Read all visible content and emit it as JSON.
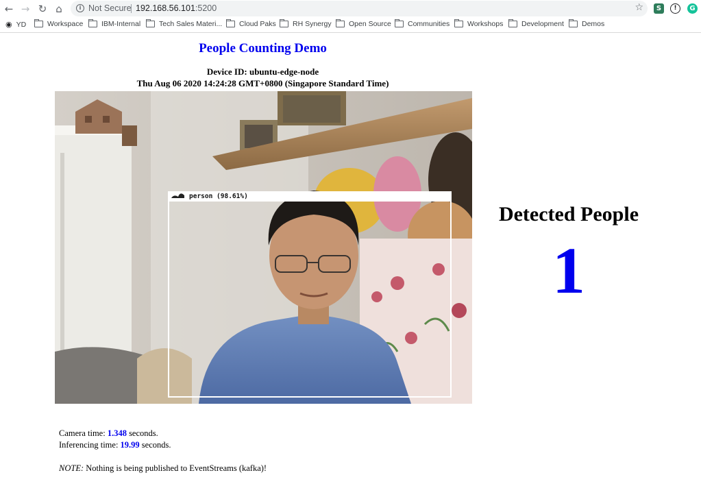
{
  "browser": {
    "security_label": "Not Secure",
    "url_host": "192.168.56.101",
    "url_port": ":5200"
  },
  "bookmarks": [
    {
      "label": "YD",
      "icon": "globe-icon"
    },
    {
      "label": "Workspace",
      "icon": "folder-icon"
    },
    {
      "label": "IBM-Internal",
      "icon": "folder-icon"
    },
    {
      "label": "Tech Sales Materi...",
      "icon": "folder-icon"
    },
    {
      "label": "Cloud Paks",
      "icon": "folder-icon"
    },
    {
      "label": "RH Synergy",
      "icon": "folder-icon"
    },
    {
      "label": "Open Source",
      "icon": "folder-icon"
    },
    {
      "label": "Communities",
      "icon": "folder-icon"
    },
    {
      "label": "Workshops",
      "icon": "folder-icon"
    },
    {
      "label": "Development",
      "icon": "folder-icon"
    },
    {
      "label": "Demos",
      "icon": "folder-icon"
    }
  ],
  "page": {
    "title": "People Counting Demo",
    "device_id": "Device ID: ubuntu-edge-node",
    "datetime": "Thu Aug 06 2020 14:24:28 GMT+0800 (Singapore Standard Time)"
  },
  "detection": {
    "label": "person (98.61%)",
    "title": "Detected People",
    "count": "1"
  },
  "stats": {
    "camera_label": "Camera time:",
    "camera_value": "1.348",
    "camera_unit": "seconds.",
    "inference_label": "Inferencing time:",
    "inference_value": "19.99",
    "inference_unit": "seconds.",
    "note_prefix": "NOTE:",
    "note_text": "Nothing is being published to EventStreams (kafka)!"
  },
  "colors": {
    "accent": "#0000ee"
  }
}
